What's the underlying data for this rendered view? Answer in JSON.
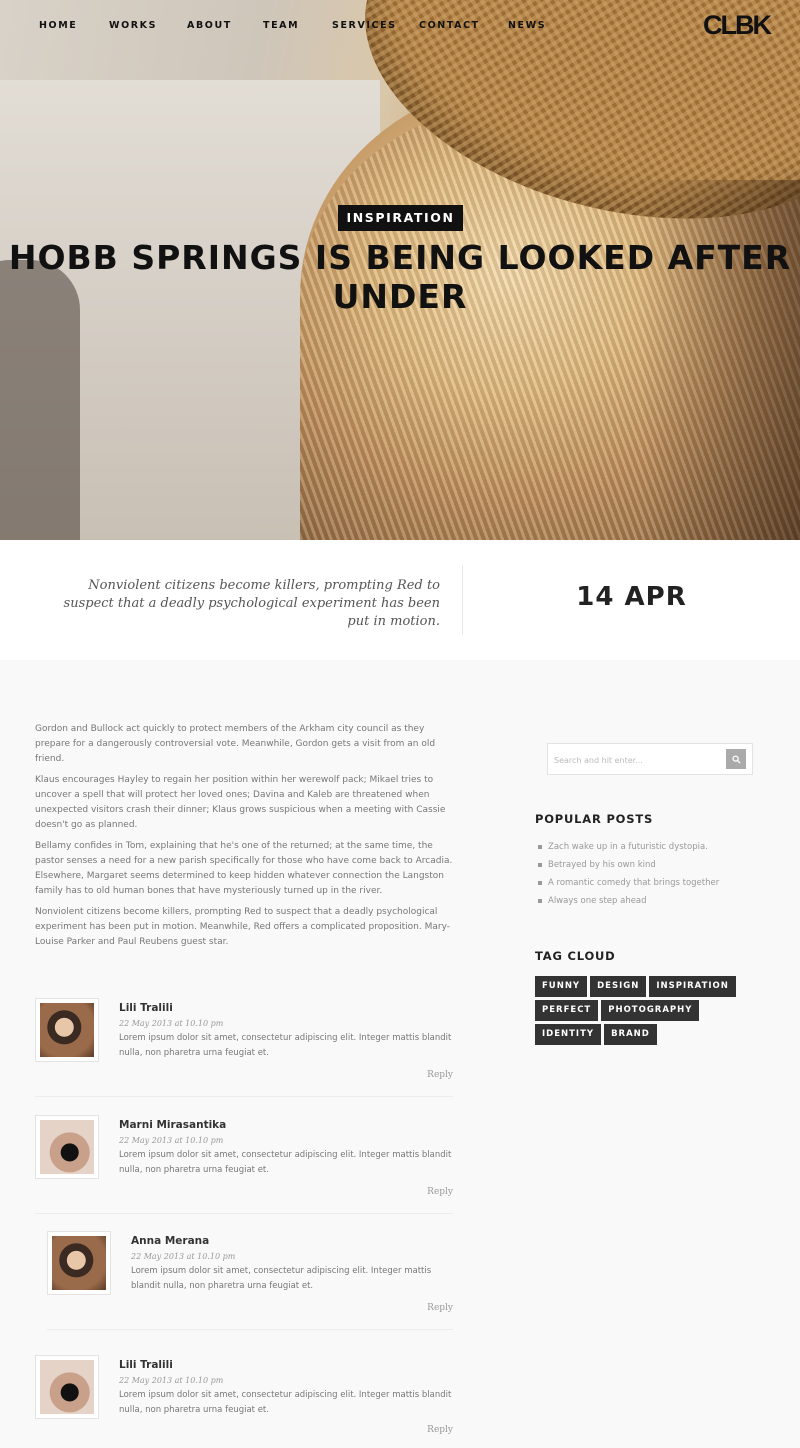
{
  "nav": {
    "items": [
      "HOME",
      "WORKS",
      "ABOUT",
      "TEAM",
      "SERVICES",
      "CONTACT",
      "NEWS"
    ],
    "logo": "CLBK"
  },
  "hero": {
    "category": "INSPIRATION",
    "title": "HOBB SPRINGS IS BEING LOOKED AFTER UNDER"
  },
  "post": {
    "excerpt": "Nonviolent citizens become killers, prompting Red to suspect that a deadly psychological experiment has been put in motion.",
    "date": "14 APR",
    "paragraphs": [
      "Gordon and Bullock act quickly to protect members of the Arkham city council as they prepare for a dangerously controversial vote. Meanwhile, Gordon gets a visit from an old friend.",
      "Klaus encourages Hayley to regain her position within her werewolf pack; Mikael tries to uncover a spell that will protect her loved ones; Davina and Kaleb are threatened when unexpected visitors crash their dinner; Klaus grows suspicious when a meeting with Cassie doesn't go as planned.",
      "Bellamy confides in Tom, explaining that he's one of the returned; at the same time, the pastor senses a need for a new parish specifically for those who have come back to Arcadia. Elsewhere, Margaret seems determined to keep hidden whatever connection the Langston family has to old human bones that have mysteriously turned up in the river.",
      "Nonviolent citizens become killers, prompting Red to suspect that a deadly psychological experiment has been put in motion. Meanwhile, Red offers a complicated proposition. Mary-Louise Parker and Paul Reubens guest star."
    ]
  },
  "comments": [
    {
      "name": "Lili Tralili",
      "date": "22 May 2013 at 10.10 pm",
      "text": "Lorem ipsum dolor sit amet, consectetur adipiscing elit. Integer mattis blandit nulla, non pharetra urna feugiat et.",
      "reply": "Reply"
    },
    {
      "name": "Marni Mirasantika",
      "date": "22 May 2013 at 10.10 pm",
      "text": "Lorem ipsum dolor sit amet, consectetur adipiscing elit. Integer mattis blandit nulla, non pharetra urna feugiat et.",
      "reply": "Reply"
    },
    {
      "name": "Anna Merana",
      "date": "22 May 2013 at 10.10 pm",
      "text": "Lorem ipsum dolor sit amet, consectetur adipiscing elit. Integer mattis blandit nulla, non pharetra urna feugiat et.",
      "reply": "Reply"
    },
    {
      "name": "Lili Tralili",
      "date": "22 May 2013 at 10.10 pm",
      "text": "Lorem ipsum dolor sit amet, consectetur adipiscing elit. Integer mattis blandit nulla, non pharetra urna feugiat et.",
      "reply": "Reply"
    }
  ],
  "sidebar": {
    "search_placeholder": "Search and hit enter...",
    "popular_title": "POPULAR POSTS",
    "popular": [
      "Zach wake up in a futuristic dystopia.",
      "Betrayed by his own kind",
      "A romantic comedy that brings together",
      "Always one step ahead"
    ],
    "tag_title": "TAG CLOUD",
    "tags": [
      "FUNNY",
      "DESIGN",
      "INSPIRATION",
      "PERFECT",
      "PHOTOGRAPHY",
      "IDENTITY",
      "BRAND"
    ]
  },
  "colors": {
    "accent": "#111111",
    "tag_bg": "#333333",
    "page_bg": "#f9f9f9"
  }
}
